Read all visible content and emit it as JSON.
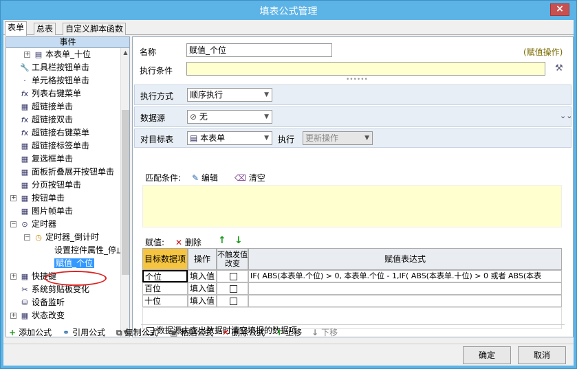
{
  "window": {
    "title": "填表公式管理",
    "close_glyph": "×"
  },
  "tabs": [
    {
      "label": "表单",
      "active": true
    },
    {
      "label": "总表",
      "active": false
    },
    {
      "label": "自定义脚本函数",
      "active": false
    }
  ],
  "event_panel": {
    "header": "事件",
    "items": [
      {
        "label": "本表单_十位",
        "icon": "table-icon"
      },
      {
        "label": "工具栏按钮单击",
        "icon": "wrench-icon"
      },
      {
        "label": "单元格按钮单击",
        "icon": "dot-icon"
      },
      {
        "label": "列表右键菜单",
        "icon": "fx-icon"
      },
      {
        "label": "超链接单击",
        "icon": "grid-icon"
      },
      {
        "label": "超链接双击",
        "icon": "fx-icon"
      },
      {
        "label": "超链接右键菜单",
        "icon": "fx-icon"
      },
      {
        "label": "超链接标签单击",
        "icon": "grid-icon"
      },
      {
        "label": "复选框单击",
        "icon": "grid-icon"
      },
      {
        "label": "面板折叠展开按钮单击",
        "icon": "grid-icon"
      },
      {
        "label": "分页按钮单击",
        "icon": "grid-icon"
      },
      {
        "label": "按钮单击",
        "icon": "grid-icon"
      },
      {
        "label": "图片帧单击",
        "icon": "grid-icon"
      },
      {
        "label": "定时器",
        "icon": "timer-icon"
      },
      {
        "label": "定时器_倒计时",
        "icon": "clock-icon"
      },
      {
        "label": "设置控件属性_停止",
        "icon": "none"
      },
      {
        "label": "赋值_个位",
        "icon": "none",
        "selected": true
      },
      {
        "label": "快捷键",
        "icon": "grid-icon"
      },
      {
        "label": "系统剪贴板变化",
        "icon": "scissors-icon"
      },
      {
        "label": "设备监听",
        "icon": "device-icon"
      },
      {
        "label": "状态改变",
        "icon": "grid-icon"
      }
    ]
  },
  "form": {
    "name_label": "名称",
    "name_value": "赋值_个位",
    "action_type_tag": "(赋值操作)",
    "condition_label": "执行条件",
    "condition_value": "",
    "exec_mode_label": "执行方式",
    "exec_mode_value": "顺序执行",
    "datasource_label": "数据源",
    "datasource_value": "无",
    "target_label": "对目标表",
    "target_value": "本表单",
    "execute_label": "执行",
    "execute_value": "更新操作"
  },
  "match": {
    "label": "匹配条件:",
    "edit_label": "编辑",
    "clear_label": "清空"
  },
  "assign": {
    "label": "赋值:",
    "delete_label": "删除",
    "up_glyph": "↑",
    "down_glyph": "↓",
    "columns": [
      "目标数据项",
      "操作",
      "不触发值改变",
      "赋值表达式"
    ],
    "rows": [
      {
        "target": "个位",
        "op": "填入值",
        "nochange": false,
        "expr": "IF( ABS(本表单.个位) > 0, 本表单.个位 - 1,IF( ABS(本表单.十位) > 0 或者 ABS(本表"
      },
      {
        "target": "百位",
        "op": "填入值",
        "nochange": false,
        "expr": ""
      },
      {
        "target": "十位",
        "op": "填入值",
        "nochange": false,
        "expr": ""
      }
    ]
  },
  "clear_checkbox_label": "数据源未查出数据时清空填报的数据项",
  "toolbar": {
    "add": "添加公式",
    "ref": "引用公式",
    "copy": "复制公式",
    "paste": "粘贴公式",
    "delete": "删除公式",
    "up": "上移",
    "down": "下移"
  },
  "buttons": {
    "ok": "确定",
    "cancel": "取消"
  },
  "colors": {
    "titlebar": "#5cb3e6",
    "yellow_field": "#ffffd0",
    "selected": "#3399ff",
    "accent_green": "#1a9a1a",
    "accent_red": "#d01010"
  }
}
